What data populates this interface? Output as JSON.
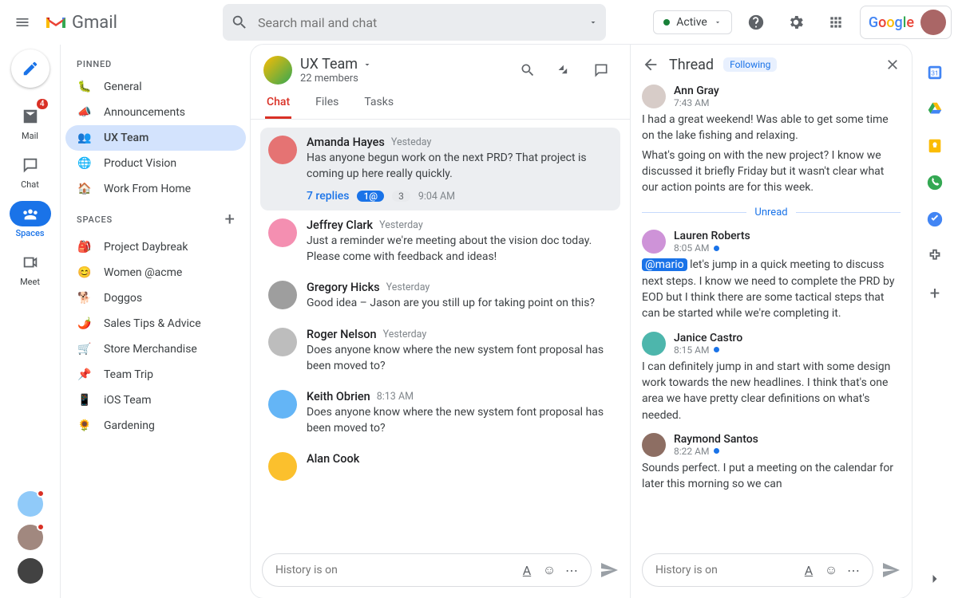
{
  "header": {
    "app_name": "Gmail",
    "search_placeholder": "Search mail and chat",
    "status_label": "Active",
    "google_label": "Google"
  },
  "rail": {
    "mail_label": "Mail",
    "mail_badge": "4",
    "chat_label": "Chat",
    "spaces_label": "Spaces",
    "meet_label": "Meet"
  },
  "sidebar": {
    "pinned_label": "PINNED",
    "spaces_label": "SPACES",
    "pinned": [
      {
        "icon": "🐛",
        "label": "General"
      },
      {
        "icon": "📣",
        "label": "Announcements"
      },
      {
        "icon": "👥",
        "label": "UX Team"
      },
      {
        "icon": "🌐",
        "label": "Product Vision"
      },
      {
        "icon": "🏠",
        "label": "Work From Home"
      }
    ],
    "spaces": [
      {
        "icon": "🎒",
        "label": "Project Daybreak"
      },
      {
        "icon": "😊",
        "label": "Women @acme"
      },
      {
        "icon": "🐕",
        "label": "Doggos"
      },
      {
        "icon": "🌶️",
        "label": "Sales Tips & Advice"
      },
      {
        "icon": "🛒",
        "label": "Store Merchandise"
      },
      {
        "icon": "📌",
        "label": "Team Trip"
      },
      {
        "icon": "📱",
        "label": "iOS Team"
      },
      {
        "icon": "🌻",
        "label": "Gardening"
      }
    ]
  },
  "space": {
    "title": "UX Team",
    "members": "22 members",
    "tabs": [
      "Chat",
      "Files",
      "Tasks"
    ]
  },
  "messages": [
    {
      "name": "Amanda Hayes",
      "time": "Yesteday",
      "text": "Has anyone begun work on the next PRD? That project is coming up here really quickly.",
      "hl": true,
      "replies": {
        "label": "7 replies",
        "chip1": "1@",
        "chip2": "3",
        "time": "9:04 AM"
      },
      "color": "#e57373"
    },
    {
      "name": "Jeffrey Clark",
      "time": "Yesterday",
      "text": "Just a reminder we're meeting about the vision doc today. Please come with feedback and ideas!",
      "color": "#f48fb1"
    },
    {
      "name": "Gregory Hicks",
      "time": "Yesterday",
      "text": "Good idea – Jason are you still up for taking point on this?",
      "color": "#9e9e9e"
    },
    {
      "name": "Roger Nelson",
      "time": "Yesterday",
      "text": "Does anyone know where the new system font proposal has been moved to?",
      "color": "#bdbdbd"
    },
    {
      "name": "Keith Obrien",
      "time": "8:13 AM",
      "text": "Does anyone know where the new system font proposal has been moved to?",
      "color": "#64b5f6"
    },
    {
      "name": "Alan Cook",
      "time": "",
      "text": "",
      "color": "#fbc02d"
    }
  ],
  "composer": {
    "placeholder": "History is on"
  },
  "thread": {
    "title": "Thread",
    "following": "Following",
    "messages": [
      {
        "name": "Ann Gray",
        "time": "7:43 AM",
        "text": "I had a great weekend! Was able to get some time on the lake fishing and relaxing.",
        "text2": "What's going on with the new project? I know we discussed it briefly Friday but it wasn't clear what our action points are for this week.",
        "color": "#d7ccc8",
        "unread_after": true
      },
      {
        "name": "Lauren Roberts",
        "time": "8:05 AM",
        "dot": true,
        "mention": "@mario",
        "text": "let's jump in a quick meeting to discuss next steps. I know we need to complete the PRD by EOD but I think there are some tactical steps that can be started while we're completing it.",
        "color": "#ce93d8"
      },
      {
        "name": "Janice Castro",
        "time": "8:15 AM",
        "dot": true,
        "text": "I can definitely jump in and start with some design work towards the new headlines. I think that's one area we have pretty clear definitions on what's needed.",
        "color": "#4db6ac"
      },
      {
        "name": "Raymond Santos",
        "time": "8:22 AM",
        "dot": true,
        "text": "Sounds perfect. I put a meeting on the calendar for later this morning so we can",
        "color": "#8d6e63"
      }
    ],
    "unread_label": "Unread"
  }
}
